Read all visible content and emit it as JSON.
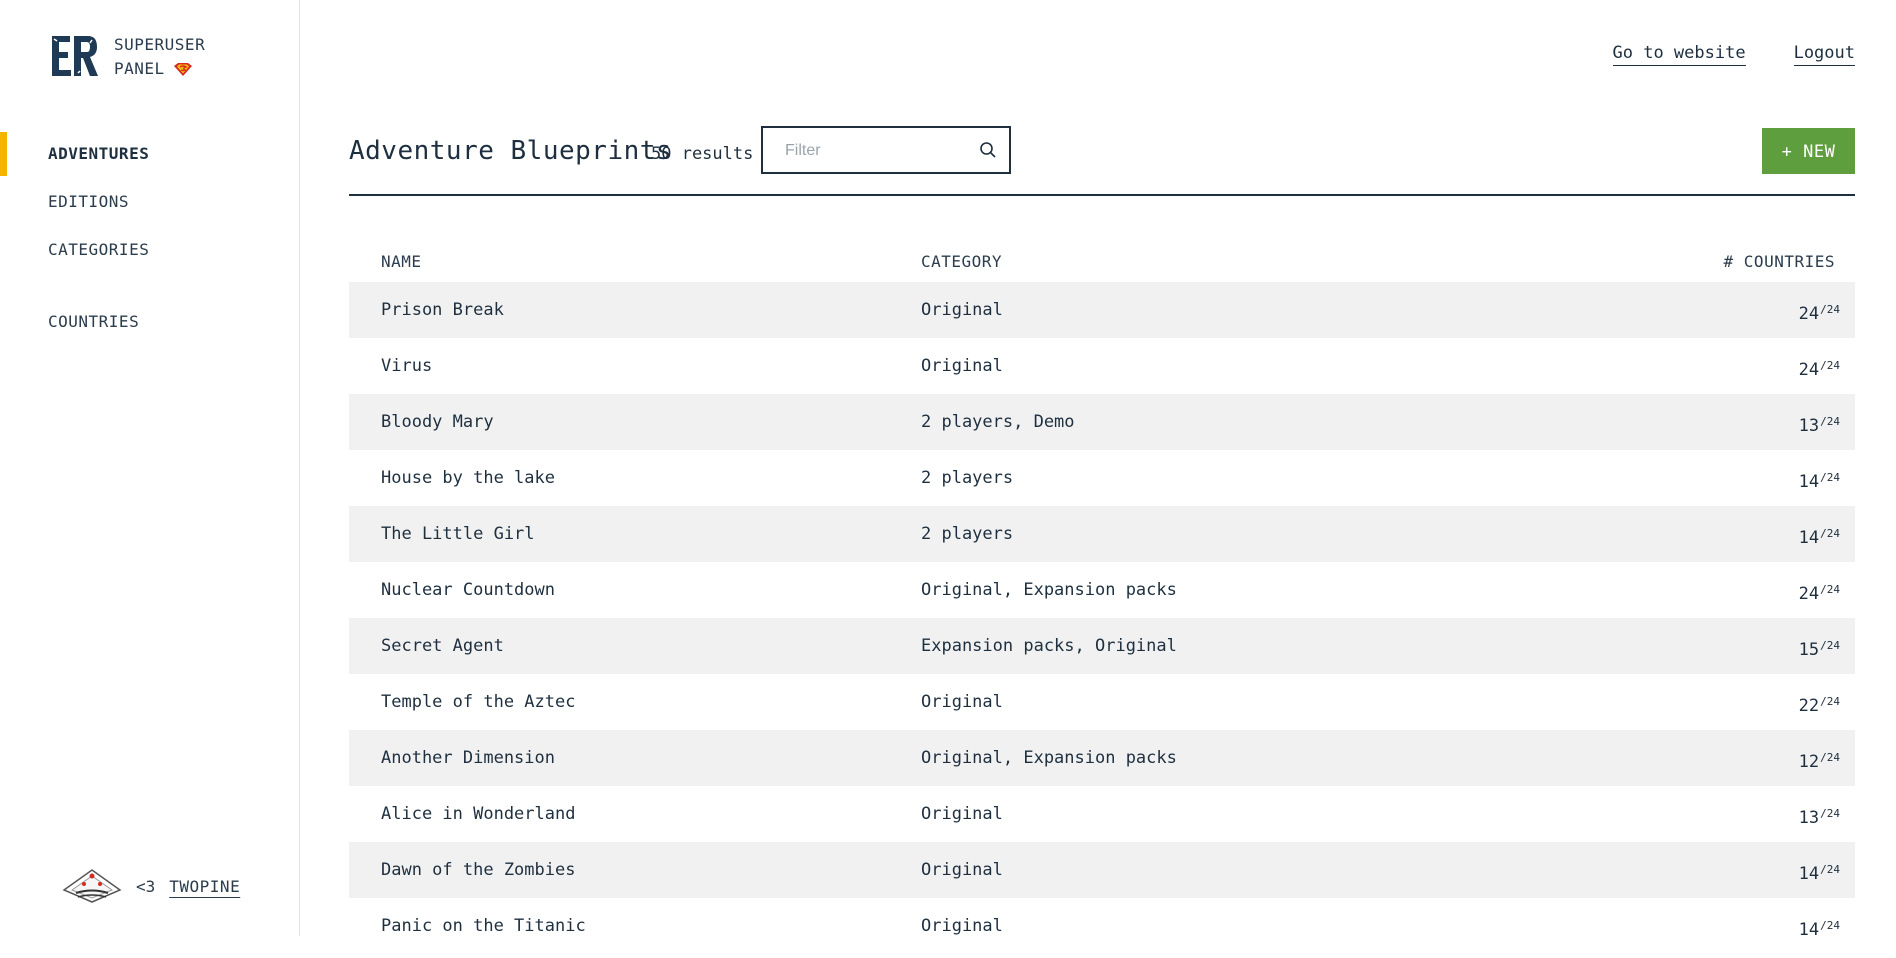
{
  "brand": {
    "logo_text": "ER",
    "line1": "SUPERUSER",
    "line2": "PANEL"
  },
  "sidebar": {
    "items": [
      {
        "label": "ADVENTURES",
        "active": true
      },
      {
        "label": "EDITIONS",
        "active": false
      },
      {
        "label": "CATEGORIES",
        "active": false
      },
      {
        "label": "COUNTRIES",
        "active": false
      }
    ],
    "footer": {
      "heart": "<3",
      "brand": "TWOPINE"
    }
  },
  "topnav": {
    "website": "Go to website",
    "logout": "Logout"
  },
  "header": {
    "title": "Adventure Blueprints",
    "count": "50 results",
    "filter_placeholder": "Filter",
    "new_label": "+ NEW"
  },
  "table": {
    "headers": {
      "name": "NAME",
      "category": "CATEGORY",
      "countries": "# COUNTRIES"
    },
    "rows": [
      {
        "name": "Prison Break",
        "category": "Original",
        "count": "24",
        "total": "/24"
      },
      {
        "name": "Virus",
        "category": "Original",
        "count": "24",
        "total": "/24"
      },
      {
        "name": "Bloody Mary",
        "category": "2 players, Demo",
        "count": "13",
        "total": "/24"
      },
      {
        "name": "House by the lake",
        "category": "2 players",
        "count": "14",
        "total": "/24"
      },
      {
        "name": "The Little Girl",
        "category": "2 players",
        "count": "14",
        "total": "/24"
      },
      {
        "name": "Nuclear Countdown",
        "category": "Original, Expansion packs",
        "count": "24",
        "total": "/24"
      },
      {
        "name": "Secret Agent",
        "category": "Expansion packs, Original",
        "count": "15",
        "total": "/24"
      },
      {
        "name": "Temple of the Aztec",
        "category": "Original",
        "count": "22",
        "total": "/24"
      },
      {
        "name": "Another Dimension",
        "category": "Original, Expansion packs",
        "count": "12",
        "total": "/24"
      },
      {
        "name": "Alice in Wonderland",
        "category": "Original",
        "count": "13",
        "total": "/24"
      },
      {
        "name": "Dawn of the Zombies",
        "category": "Original",
        "count": "14",
        "total": "/24"
      },
      {
        "name": "Panic on the Titanic",
        "category": "Original",
        "count": "14",
        "total": "/24"
      }
    ]
  },
  "colors": {
    "accent": "#f4b400",
    "primary": "#1e2f3f",
    "new_button": "#5f9e3f",
    "row_alt": "#f1f1f1"
  },
  "icons": {
    "brand": "er-logo-icon",
    "shield": "superman-shield-icon",
    "search": "search-icon",
    "footer": "twopine-logo-icon"
  }
}
